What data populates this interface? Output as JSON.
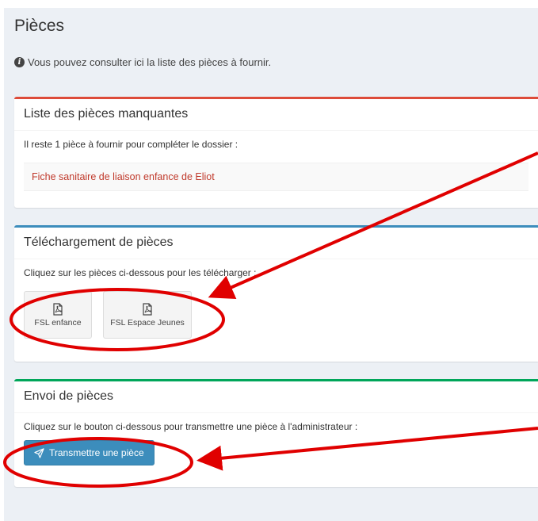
{
  "page": {
    "title": "Pièces",
    "info_text": "Vous pouvez consulter ici la liste des pièces à fournir.",
    "info_icon": "info-icon"
  },
  "missing_box": {
    "title": "Liste des pièces manquantes",
    "summary": "Il reste 1 pièce à fournir pour compléter le dossier :",
    "items": [
      "Fiche sanitaire de liaison enfance de Eliot"
    ],
    "accent_color": "#dd4b39"
  },
  "download_box": {
    "title": "Téléchargement de pièces",
    "instruction": "Cliquez sur les pièces ci-dessous pour les télécharger :",
    "files": [
      {
        "label": "FSL enfance",
        "icon": "pdf-icon"
      },
      {
        "label": "FSL Espace Jeunes",
        "icon": "pdf-icon"
      }
    ],
    "accent_color": "#3c8dbc"
  },
  "upload_box": {
    "title": "Envoi de pièces",
    "instruction": "Cliquez sur le bouton ci-dessous pour transmettre une pièce à l'administrateur :",
    "button_label": "Transmettre une pièce",
    "button_icon": "paper-plane-icon",
    "accent_color": "#00a65a"
  },
  "annotations": {
    "color": "#e00000"
  }
}
